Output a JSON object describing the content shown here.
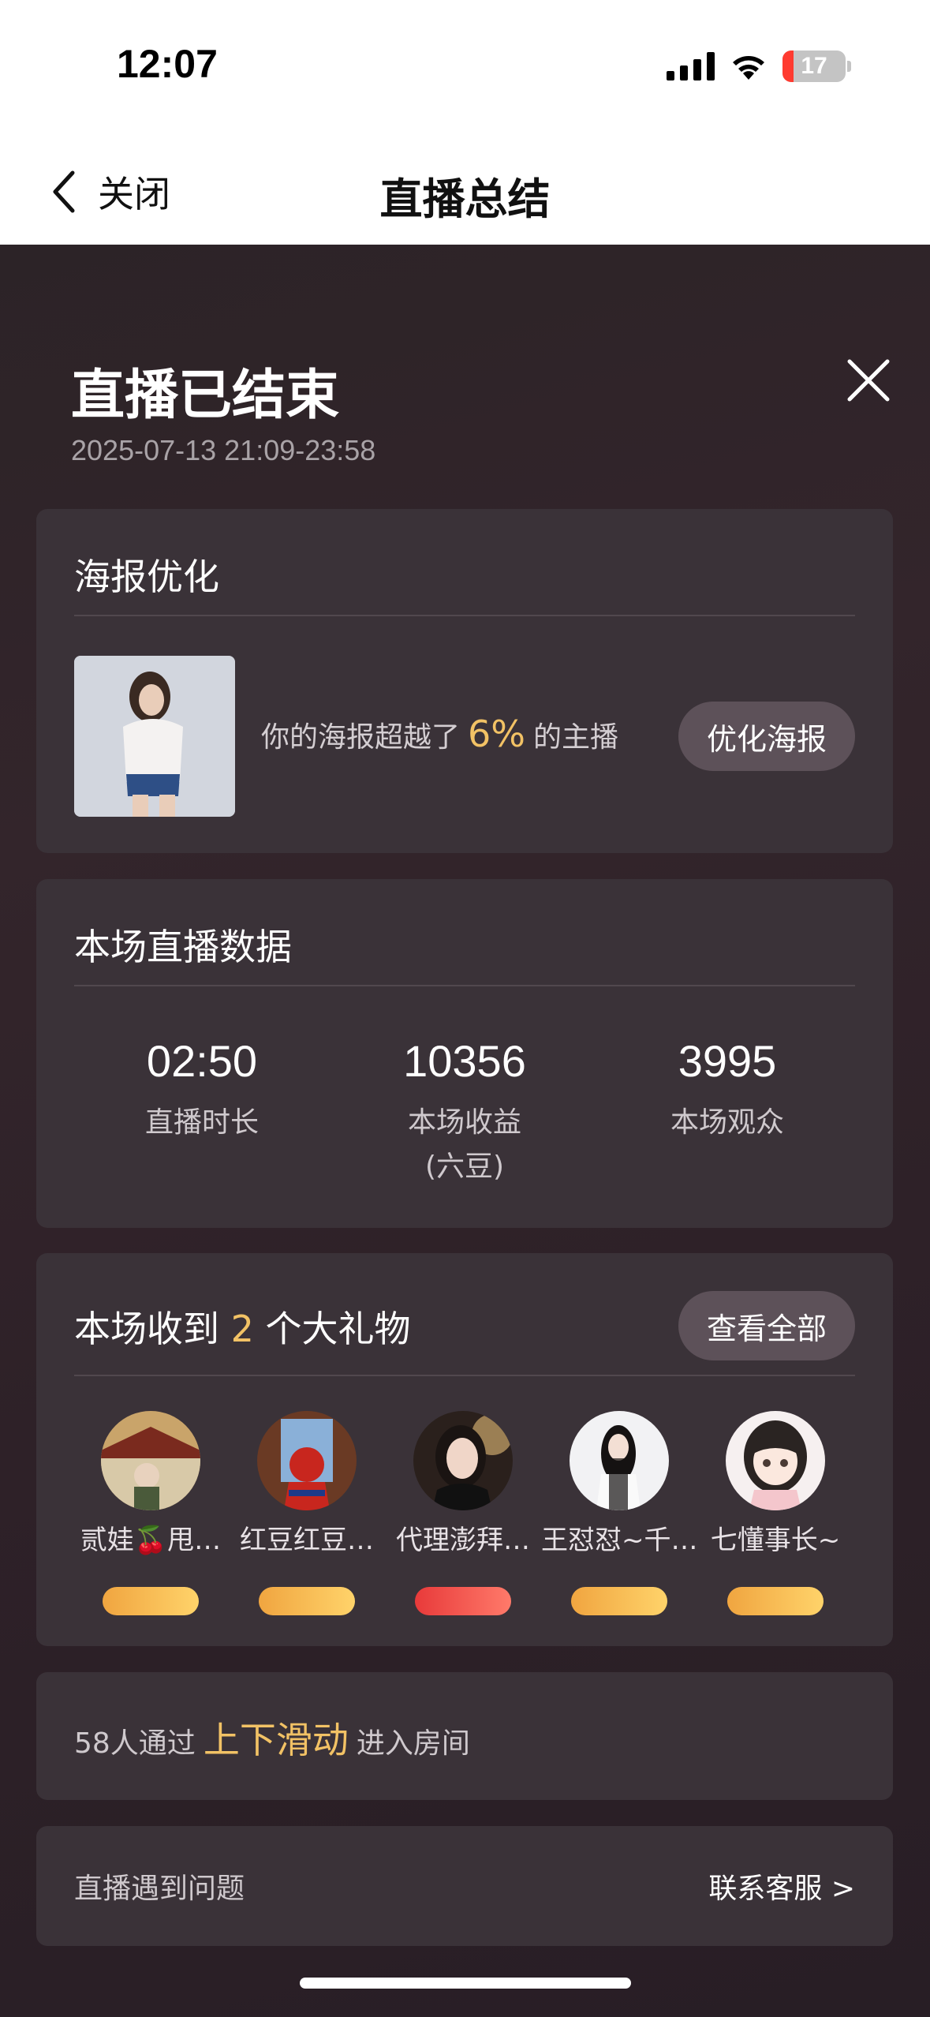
{
  "status_bar": {
    "time": "12:07",
    "battery": "17"
  },
  "nav": {
    "back_label": "关闭",
    "title": "直播总结"
  },
  "summary": {
    "heading": "直播已结束",
    "time_range": "2025-07-13 21:09-23:58"
  },
  "poster": {
    "title": "海报优化",
    "text_before": "你的海报超越了",
    "percent": "6%",
    "text_after": "的主播",
    "button": "优化海报"
  },
  "stats": {
    "title": "本场直播数据",
    "items": [
      {
        "value": "02:50",
        "label": "直播时长"
      },
      {
        "value": "10356",
        "label": "本场收益\n(六豆)"
      },
      {
        "value": "3995",
        "label": "本场观众"
      }
    ]
  },
  "gifts": {
    "title_before": "本场收到",
    "count": "2",
    "title_after": "个大礼物",
    "button": "查看全部",
    "gifters": [
      {
        "name": "贰娃🍒甩…"
      },
      {
        "name": "红豆红豆…"
      },
      {
        "name": "代理澎拜…"
      },
      {
        "name": "王怼怼~千…"
      },
      {
        "name": "七懂事长~"
      }
    ]
  },
  "slide": {
    "count_text": "58人通过",
    "highlight": "上下滑动",
    "suffix": "进入房间"
  },
  "support": {
    "label": "直播遇到问题",
    "link": "联系客服 >"
  },
  "colors": {
    "accent": "#f2c265",
    "card": "#3a3238",
    "pill": "#5d5159"
  }
}
